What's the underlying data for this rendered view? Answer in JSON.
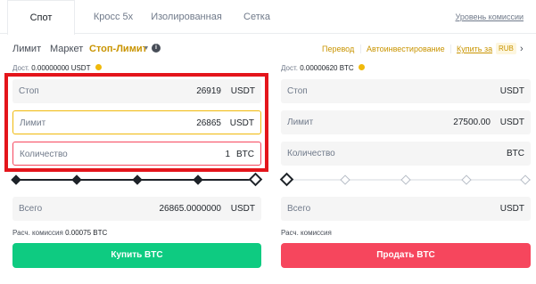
{
  "tabs": [
    {
      "label": "Спот",
      "active": true
    },
    {
      "label": "Кросс 5x"
    },
    {
      "label": "Изолированная"
    },
    {
      "label": "Сетка"
    }
  ],
  "fee_level_link": "Уровень комиссии",
  "order_types": {
    "limit": "Лимит",
    "market": "Маркет",
    "stop_limit": "Стоп-Лимит",
    "caret": "▼",
    "info": "i"
  },
  "right_links": {
    "transfer": "Перевод",
    "auto_invest": "Автоинвестирование",
    "buy_with": "Купить за",
    "currency_badge": "RUB",
    "chevron": "›"
  },
  "buy": {
    "balance_label": "Дост.",
    "balance_value": "0.00000000 USDT",
    "stop_label": "Стоп",
    "stop_value": "26919",
    "stop_unit": "USDT",
    "limit_label": "Лимит",
    "limit_value": "26865",
    "limit_unit": "USDT",
    "qty_label": "Количество",
    "qty_value": "1",
    "qty_unit": "BTC",
    "slider_percent": 100,
    "total_label": "Всего",
    "total_value": "26865.0000000",
    "total_unit": "USDT",
    "fee_label": "Расч. комиссия",
    "fee_value": "0.00075 BTC",
    "button": "Купить BTC"
  },
  "sell": {
    "balance_label": "Дост.",
    "balance_value": "0.00000620 BTC",
    "stop_label": "Стоп",
    "stop_unit": "USDT",
    "limit_label": "Лимит",
    "limit_value": "27500.00",
    "limit_unit": "USDT",
    "qty_label": "Количество",
    "qty_unit": "BTC",
    "slider_percent": 0,
    "total_label": "Всего",
    "total_unit": "USDT",
    "fee_label": "Расч. комиссия",
    "button": "Продать BTC"
  },
  "colors": {
    "accent": "#f0b90b",
    "buy": "#0ecb81",
    "sell": "#f6465d",
    "highlight": "#e4151b"
  }
}
